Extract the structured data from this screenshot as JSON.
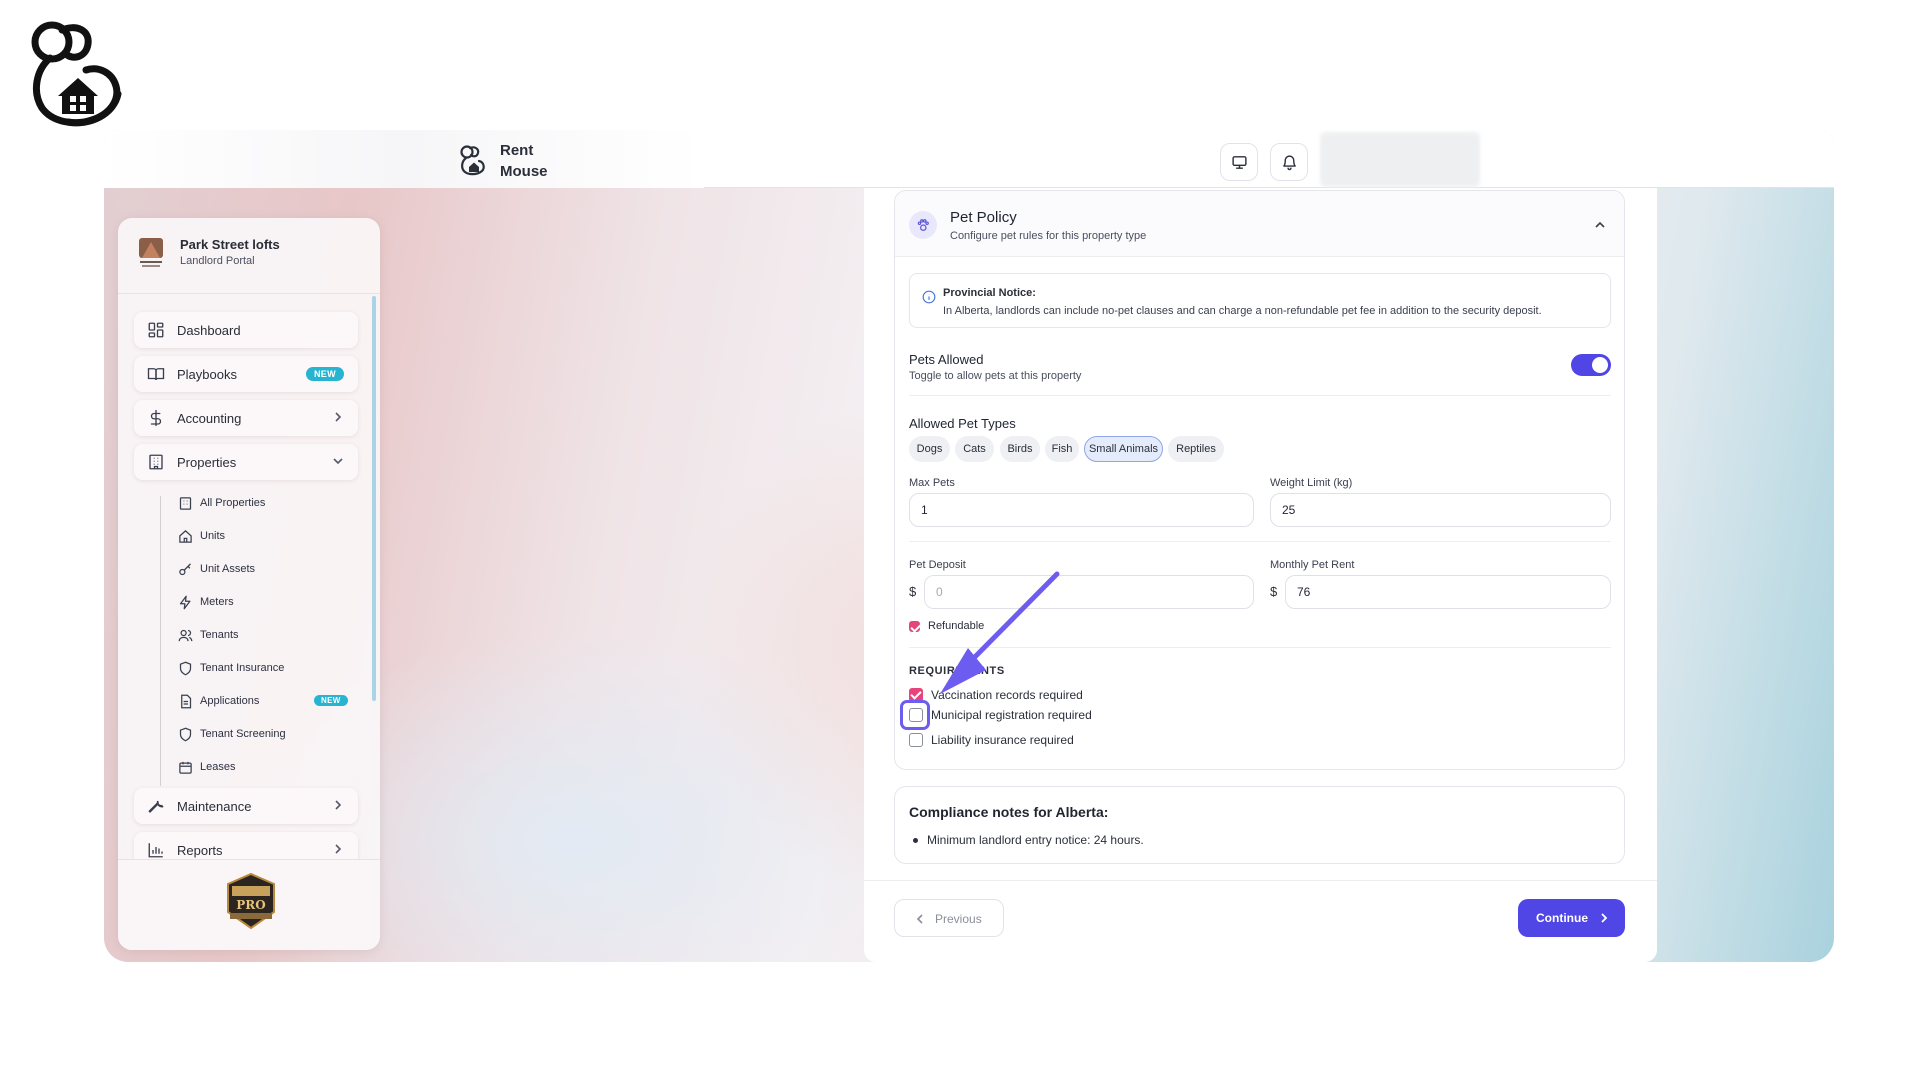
{
  "header": {
    "app_name_line1": "Rent",
    "app_name_line2": "Mouse"
  },
  "sidebar": {
    "org_name": "Park Street lofts",
    "org_sub": "Landlord Portal",
    "items": [
      {
        "label": "Dashboard",
        "icon": "dashboard-icon"
      },
      {
        "label": "Playbooks",
        "icon": "book-icon",
        "badge": "NEW"
      },
      {
        "label": "Accounting",
        "icon": "dollar-icon"
      },
      {
        "label": "Properties",
        "icon": "building-icon"
      },
      {
        "label": "Maintenance",
        "icon": "wrench-icon"
      },
      {
        "label": "Reports",
        "icon": "bar-chart-icon"
      }
    ],
    "properties_sub": [
      {
        "label": "All Properties",
        "icon": "building-icon"
      },
      {
        "label": "Units",
        "icon": "home-icon"
      },
      {
        "label": "Unit Assets",
        "icon": "key-icon"
      },
      {
        "label": "Meters",
        "icon": "bolt-icon"
      },
      {
        "label": "Tenants",
        "icon": "users-icon"
      },
      {
        "label": "Tenant Insurance",
        "icon": "shield-icon"
      },
      {
        "label": "Applications",
        "icon": "document-icon",
        "badge": "NEW"
      },
      {
        "label": "Tenant Screening",
        "icon": "shield-icon"
      },
      {
        "label": "Leases",
        "icon": "calendar-icon"
      }
    ],
    "footer_badge_alt": "RentMouse PRO Founding Member"
  },
  "pet_policy": {
    "title": "Pet Policy",
    "subtitle": "Configure pet rules for this property type",
    "notice_title": "Provincial Notice:",
    "notice_body": "In Alberta, landlords can include no-pet clauses and can charge a non-refundable pet fee in addition to the security deposit.",
    "pets_allowed_label": "Pets Allowed",
    "pets_allowed_sub": "Toggle to allow pets at this property",
    "pets_allowed": true,
    "types_label": "Allowed Pet Types",
    "types": [
      {
        "label": "Dogs",
        "selected": false
      },
      {
        "label": "Cats",
        "selected": false
      },
      {
        "label": "Birds",
        "selected": false
      },
      {
        "label": "Fish",
        "selected": false
      },
      {
        "label": "Small Animals",
        "selected": true
      },
      {
        "label": "Reptiles",
        "selected": false
      }
    ],
    "max_pets_label": "Max Pets",
    "max_pets_value": "1",
    "weight_limit_label": "Weight Limit (kg)",
    "weight_limit_value": "25",
    "pet_deposit_label": "Pet Deposit",
    "pet_deposit_placeholder": "0",
    "monthly_rent_label": "Monthly Pet Rent",
    "monthly_rent_value": "76",
    "currency_symbol": "$",
    "refundable_label": "Refundable",
    "refundable": true,
    "requirements_title": "REQUIREMENTS",
    "requirements": [
      {
        "label": "Vaccination records required",
        "checked": true
      },
      {
        "label": "Municipal registration required",
        "checked": false
      },
      {
        "label": "Liability insurance required",
        "checked": false
      }
    ]
  },
  "compliance": {
    "title": "Compliance notes for Alberta:",
    "items": [
      "Minimum landlord entry notice: 24 hours."
    ]
  },
  "footer": {
    "previous_label": "Previous",
    "continue_label": "Continue"
  },
  "colors": {
    "accent": "#4f46e5",
    "checkbox_on": "#e5457a",
    "badge_new": "#27b4d1",
    "annotation": "#6d5cf0"
  }
}
